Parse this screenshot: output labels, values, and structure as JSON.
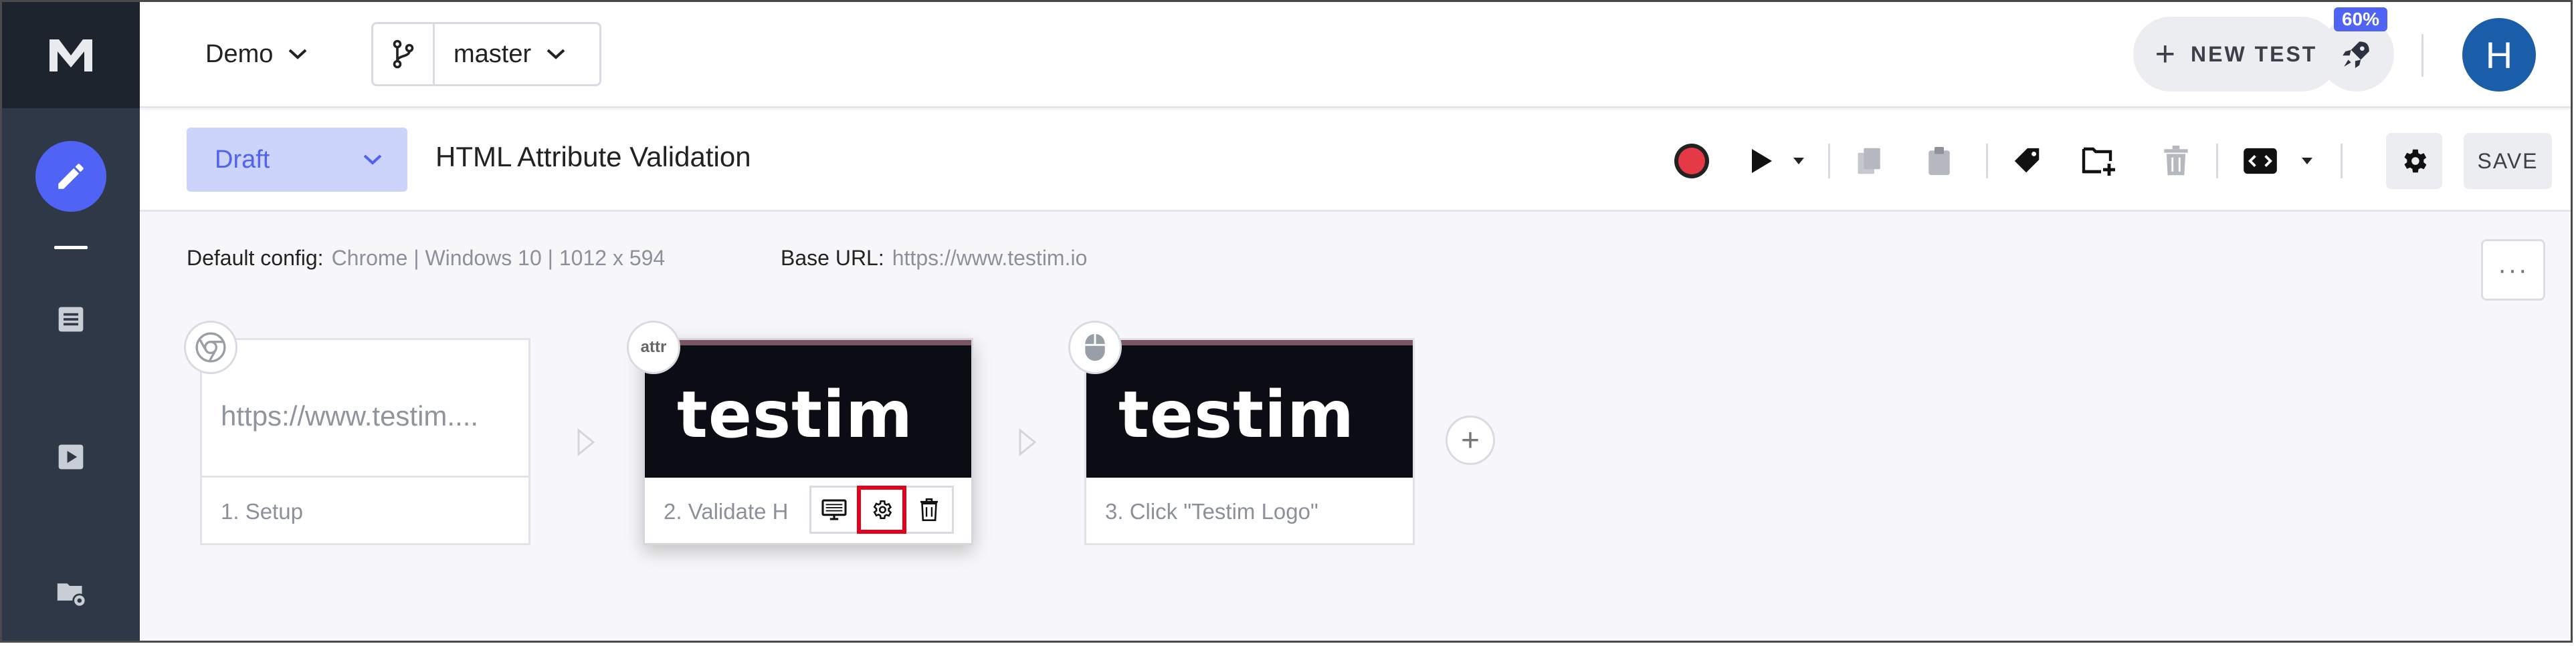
{
  "header": {
    "project": "Demo",
    "branch": "master",
    "new_test_label": "NEW TEST",
    "notification_badge": "60%",
    "avatar_initial": "H"
  },
  "sidebar": {
    "items": [
      {
        "name": "editor",
        "icon": "pencil-icon",
        "active": true
      },
      {
        "name": "tests",
        "icon": "list-icon"
      },
      {
        "name": "runs",
        "icon": "play-icon"
      },
      {
        "name": "settings",
        "icon": "folder-gear-icon"
      }
    ]
  },
  "toolbar": {
    "status": "Draft",
    "test_name": "HTML Attribute Validation",
    "save_label": "SAVE",
    "icons": [
      "record-icon",
      "play-icon",
      "copy-icon",
      "paste-icon",
      "tag-icon",
      "add-folder-icon",
      "trash-icon",
      "code-icon",
      "gear-icon"
    ]
  },
  "config": {
    "default_label": "Default config:",
    "default_value": "Chrome | Windows 10 | 1012 x 594",
    "base_url_label": "Base URL:",
    "base_url_value": "https://www.testim.io"
  },
  "steps": [
    {
      "label": "1. Setup",
      "preview_text": "https://www.testim....",
      "badge": "chrome-icon"
    },
    {
      "label": "2. Validate H",
      "preview_text": "testim",
      "badge_text": "attr"
    },
    {
      "label": "3. Click \"Testim Logo\"",
      "preview_text": "testim",
      "badge": "mouse-icon"
    }
  ],
  "more_label": "···",
  "colors": {
    "accent": "#4f63f4",
    "sidebar": "#2f3847",
    "highlight": "#e3001b",
    "record": "#e53945"
  }
}
